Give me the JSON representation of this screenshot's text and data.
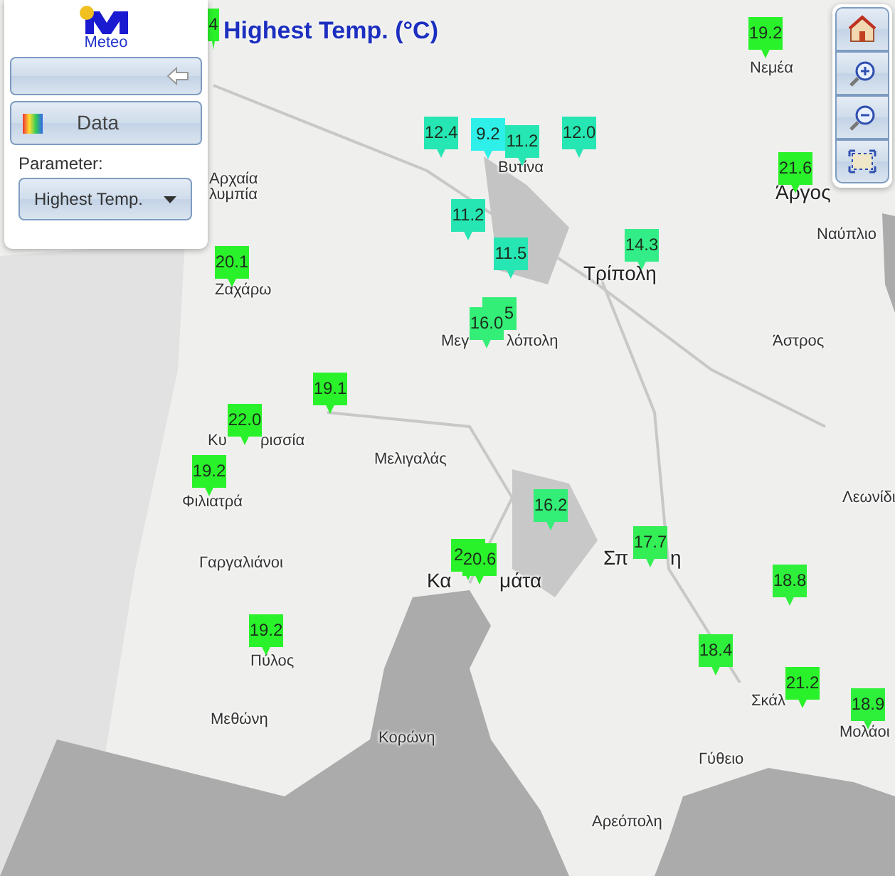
{
  "title": "Highest Temp. (°C)",
  "panel": {
    "logo_text": "Meteo",
    "data_button": "Data",
    "parameter_label": "Parameter:",
    "parameter_value": "Highest Temp."
  },
  "places": [
    {
      "name": "Νεμέα"
    },
    {
      "name": "Αρχαία"
    },
    {
      "name": "λυμπία"
    },
    {
      "name": "Βυτίνα"
    },
    {
      "name": "Άργος"
    },
    {
      "name": "Ναύπλιο"
    },
    {
      "name": "Τρίπολη"
    },
    {
      "name": "Ζαχάρω"
    },
    {
      "name": "Μεγ"
    },
    {
      "name": "λόπολη"
    },
    {
      "name": "Άστρος"
    },
    {
      "name": "Κυ"
    },
    {
      "name": "ρισσία"
    },
    {
      "name": "Μελιγαλάς"
    },
    {
      "name": "Λεωνίδι"
    },
    {
      "name": "Φιλιατρά"
    },
    {
      "name": "Γαργαλιάνοι"
    },
    {
      "name": "Κα"
    },
    {
      "name": "μάτα"
    },
    {
      "name": "Σπ"
    },
    {
      "name": "η"
    },
    {
      "name": "Πύλος"
    },
    {
      "name": "Σκάλ"
    },
    {
      "name": "Μεθώνη"
    },
    {
      "name": "Μολάοι"
    },
    {
      "name": "Κορώνη"
    },
    {
      "name": "Γύθειο"
    },
    {
      "name": "Αρεόπολη"
    }
  ],
  "markers": [
    {
      "value": "4",
      "color": "#2af22a"
    },
    {
      "value": "19.2",
      "color": "#2af22a"
    },
    {
      "value": "12.4",
      "color": "#26e6b4"
    },
    {
      "value": "9.2",
      "color": "#2ef0e8"
    },
    {
      "value": "11.2",
      "color": "#26e6b4"
    },
    {
      "value": "12.0",
      "color": "#26e6b4"
    },
    {
      "value": "21.6",
      "color": "#2af22a"
    },
    {
      "value": "11.2",
      "color": "#26e6b4"
    },
    {
      "value": "11.5",
      "color": "#26e6b4"
    },
    {
      "value": "14.3",
      "color": "#33ee88"
    },
    {
      "value": "20.1",
      "color": "#2af22a"
    },
    {
      "value": "5",
      "color": "#33ee77"
    },
    {
      "value": "16.0",
      "color": "#33ee77"
    },
    {
      "value": "19.1",
      "color": "#2af22a"
    },
    {
      "value": "22.0",
      "color": "#2af22a"
    },
    {
      "value": "19.2",
      "color": "#2af22a"
    },
    {
      "value": "16.2",
      "color": "#33ee77"
    },
    {
      "value": "2",
      "color": "#2af22a"
    },
    {
      "value": "20.6",
      "color": "#2af22a"
    },
    {
      "value": "17.7",
      "color": "#33ee55"
    },
    {
      "value": "18.8",
      "color": "#2ef03a"
    },
    {
      "value": "19.2",
      "color": "#2af22a"
    },
    {
      "value": "18.4",
      "color": "#2ef03a"
    },
    {
      "value": "21.2",
      "color": "#2af22a"
    },
    {
      "value": "18.9",
      "color": "#2ef03a"
    }
  ]
}
